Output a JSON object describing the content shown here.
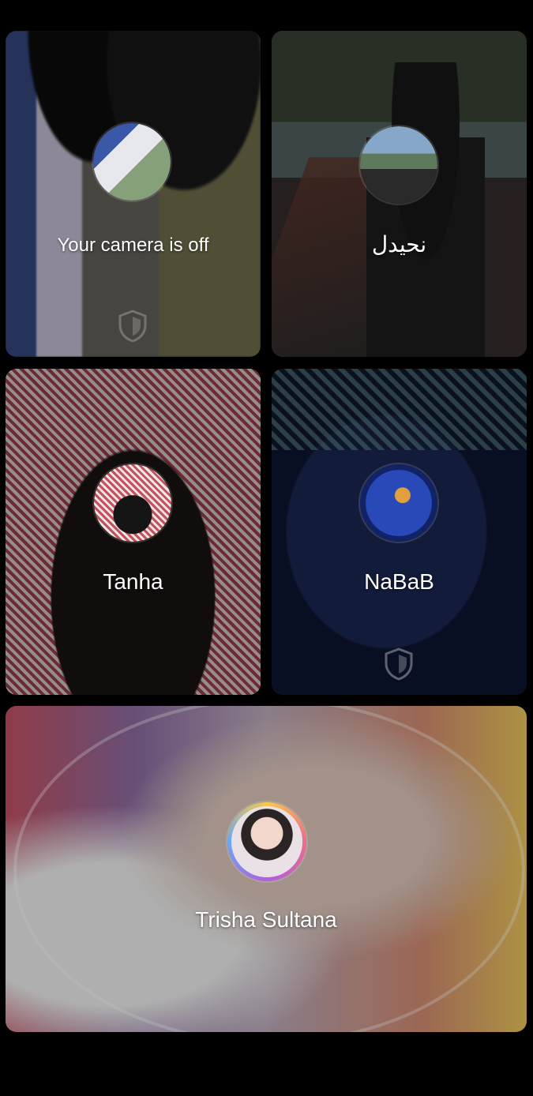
{
  "participants": [
    {
      "id": "self",
      "label": "Your camera is off",
      "shield": true
    },
    {
      "id": "p2",
      "label": "نحيدل",
      "shield": false
    },
    {
      "id": "p3",
      "label": "Tanha",
      "shield": false
    },
    {
      "id": "p4",
      "label": "NaBaB",
      "shield": true
    },
    {
      "id": "p5",
      "label": "Trisha Sultana",
      "shield": false
    }
  ],
  "icons": {
    "shield": "shield-icon"
  },
  "colors": {
    "background": "#000000",
    "text": "#ffffff"
  }
}
